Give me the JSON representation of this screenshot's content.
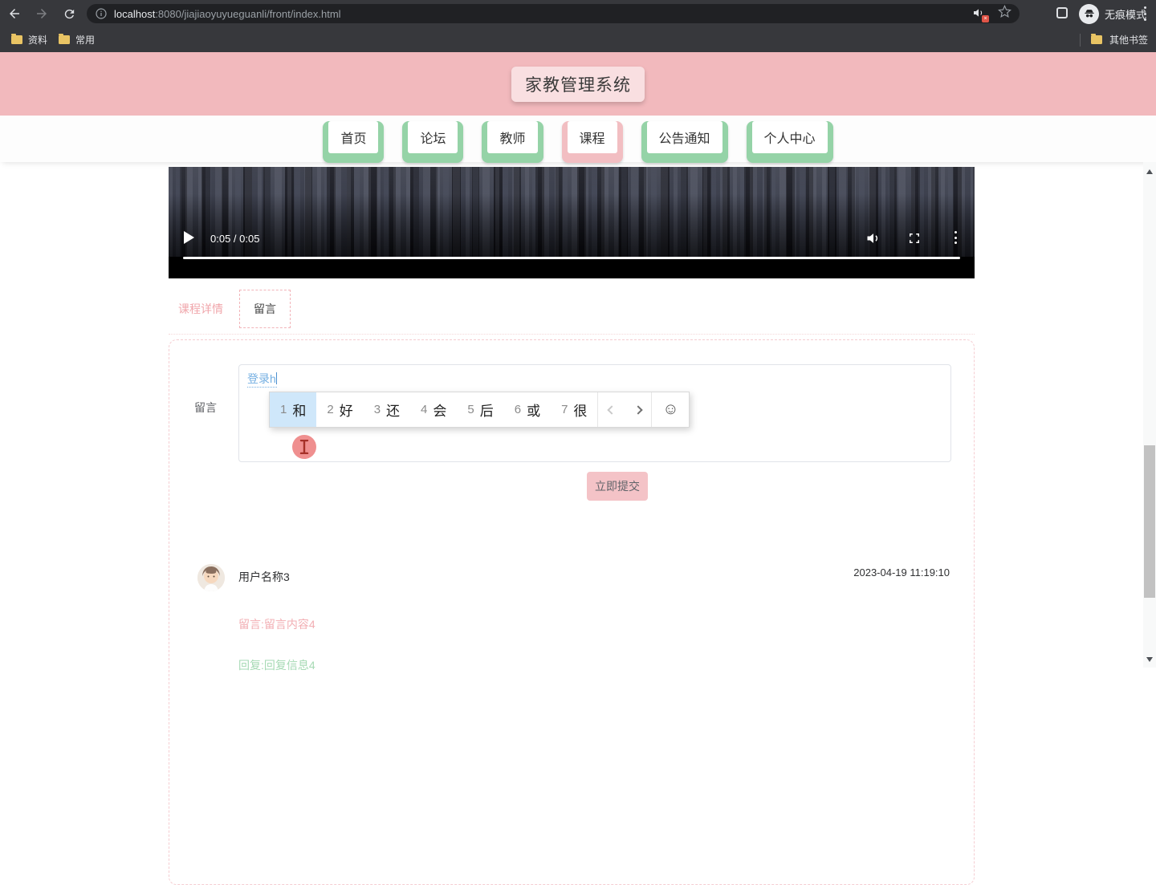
{
  "browser": {
    "url": {
      "host": "localhost",
      "rest": ":8080/jiajiaoyuyueguanli/front/index.html"
    },
    "incognito_label": "无痕模式",
    "bookmarks": [
      {
        "label": "资料"
      },
      {
        "label": "常用"
      }
    ],
    "other_bookmarks": "其他书签"
  },
  "header": {
    "title": "家教管理系统"
  },
  "nav": {
    "items": [
      {
        "label": "首页"
      },
      {
        "label": "论坛"
      },
      {
        "label": "教师"
      },
      {
        "label": "课程"
      },
      {
        "label": "公告通知"
      },
      {
        "label": "个人中心"
      }
    ]
  },
  "video": {
    "time": "0:05 / 0:05"
  },
  "tabs": {
    "detail": "课程详情",
    "message": "留言"
  },
  "form": {
    "label": "留言",
    "composition": "登录h",
    "ime": {
      "candidates": [
        {
          "num": "1",
          "char": "和"
        },
        {
          "num": "2",
          "char": "好"
        },
        {
          "num": "3",
          "char": "还"
        },
        {
          "num": "4",
          "char": "会"
        },
        {
          "num": "5",
          "char": "后"
        },
        {
          "num": "6",
          "char": "或"
        },
        {
          "num": "7",
          "char": "很"
        }
      ]
    },
    "submit_label": "立即提交"
  },
  "comments": [
    {
      "user": "用户名称3",
      "time": "2023-04-19 11:19:10",
      "message": "留言:留言内容4",
      "reply": "回复:回复信息4"
    }
  ],
  "colors": {
    "header_pink": "#f2b9bd",
    "nav_green": "#95d3a7",
    "active_pink": "#f2bec2",
    "submit_pink": "#f4c3c7",
    "message_pink": "#f2aeb3",
    "reply_green": "#a6dab4"
  }
}
